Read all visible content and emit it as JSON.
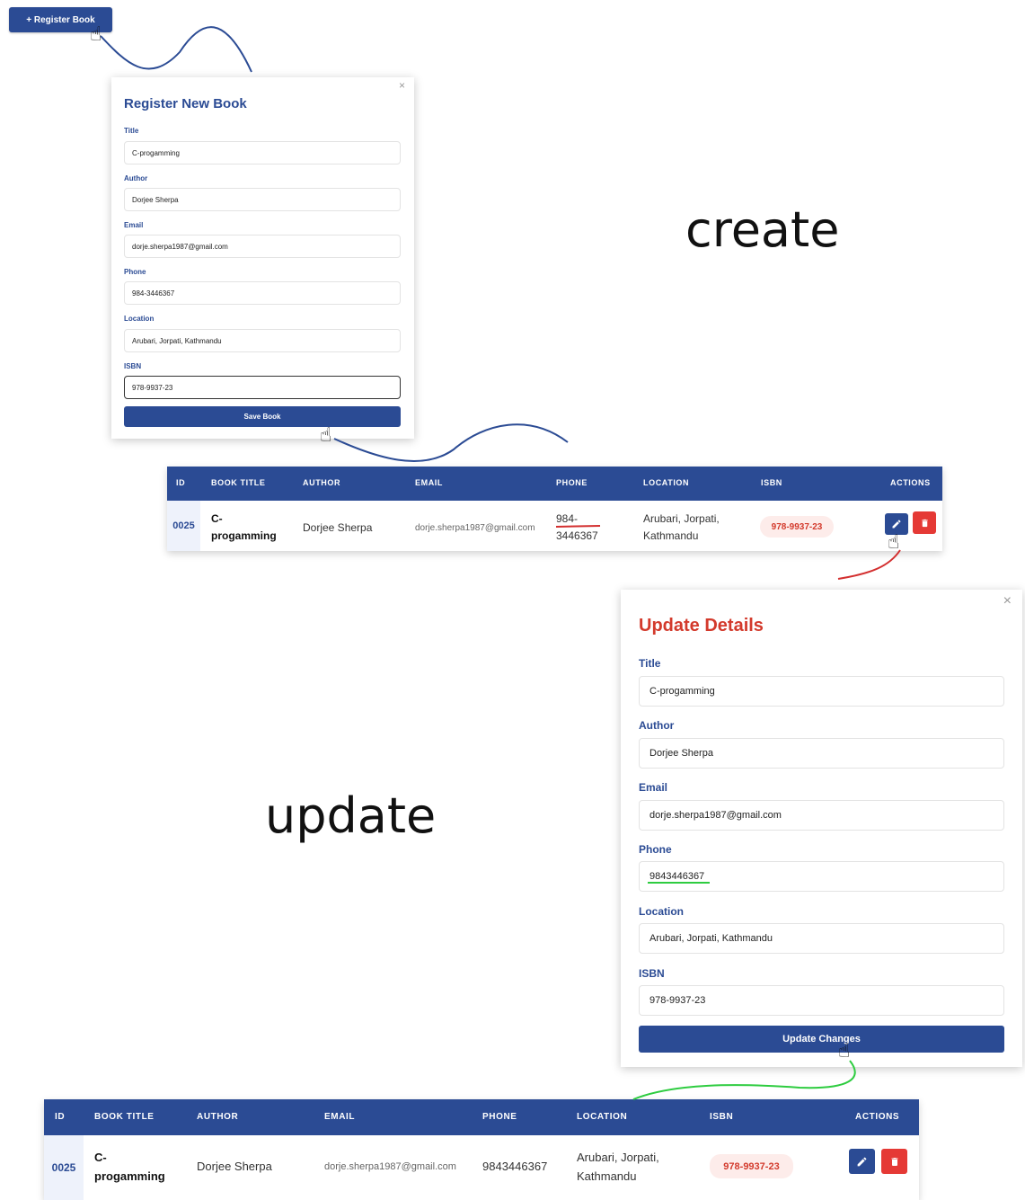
{
  "register_button": {
    "label": "+ Register Book"
  },
  "create_modal": {
    "title": "Register New Book",
    "close": "×",
    "fields": [
      {
        "label": "Title",
        "value": "C-progamming"
      },
      {
        "label": "Author",
        "value": "Dorjee Sherpa"
      },
      {
        "label": "Email",
        "value": "dorje.sherpa1987@gmail.com"
      },
      {
        "label": "Phone",
        "value": "984-3446367"
      },
      {
        "label": "Location",
        "value": "Arubari, Jorpati, Kathmandu"
      },
      {
        "label": "ISBN",
        "value": "978-9937-23"
      }
    ],
    "submit_label": "Save Book"
  },
  "captions": {
    "create": "create",
    "update": "update"
  },
  "table_1": {
    "headers": [
      "ID",
      "BOOK TITLE",
      "AUTHOR",
      "EMAIL",
      "PHONE",
      "LOCATION",
      "ISBN",
      "ACTIONS"
    ],
    "row": {
      "id": "0025",
      "title_line1": "C-",
      "title_line2": "progamming",
      "author": "Dorjee Sherpa",
      "email": "dorje.sherpa1987@gmail.com",
      "phone_line1": "984-",
      "phone_line2": "3446367",
      "location_line1": "Arubari, Jorpati,",
      "location_line2": "Kathmandu",
      "isbn": "978-9937-23"
    }
  },
  "update_modal": {
    "title": "Update Details",
    "close": "×",
    "fields": [
      {
        "label": "Title",
        "value": "C-progamming"
      },
      {
        "label": "Author",
        "value": "Dorjee Sherpa"
      },
      {
        "label": "Email",
        "value": "dorje.sherpa1987@gmail.com"
      },
      {
        "label": "Phone",
        "value": "9843446367"
      },
      {
        "label": "Location",
        "value": "Arubari, Jorpati, Kathmandu"
      },
      {
        "label": "ISBN",
        "value": "978-9937-23"
      }
    ],
    "submit_label": "Update Changes"
  },
  "table_2": {
    "headers": [
      "ID",
      "BOOK TITLE",
      "AUTHOR",
      "EMAIL",
      "PHONE",
      "LOCATION",
      "ISBN",
      "ACTIONS"
    ],
    "row": {
      "id": "0025",
      "title_line1": "C-",
      "title_line2": "progamming",
      "author": "Dorjee Sherpa",
      "email": "dorje.sherpa1987@gmail.com",
      "phone": "9843446367",
      "location_line1": "Arubari, Jorpati,",
      "location_line2": "Kathmandu",
      "isbn": "978-9937-23"
    }
  },
  "icons": {
    "edit": "pencil-icon",
    "delete": "trash-icon",
    "cursor": "pointer-hand-icon"
  },
  "colors": {
    "primary": "#2b4b94",
    "update_title": "#d33a2c",
    "delete": "#e53935",
    "annotation_blue": "#2b4b94",
    "annotation_red": "#d32f2f",
    "annotation_green": "#2ecc40"
  }
}
